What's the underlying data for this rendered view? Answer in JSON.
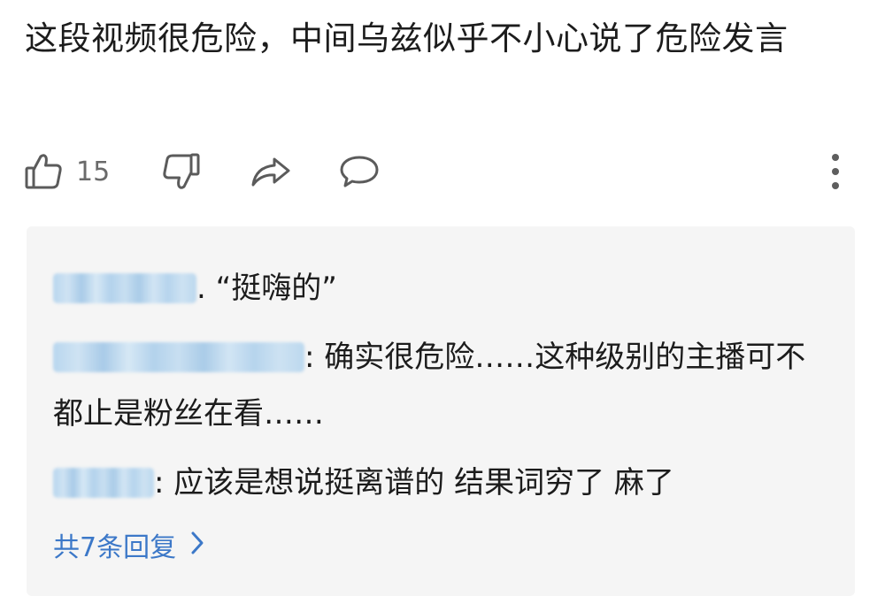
{
  "comment": {
    "text": "这段视频很危险，中间乌兹似乎不小心说了危险发言",
    "like_count": "15"
  },
  "icons": {
    "like": "thumbs-up-icon",
    "dislike": "thumbs-down-icon",
    "share": "share-icon",
    "reply": "comment-bubble-icon",
    "more": "more-vertical-icon",
    "expand": "chevron-right-icon"
  },
  "replies": [
    {
      "user": "[blurred username]",
      "separator": ". ",
      "text": "“挺嗨的”"
    },
    {
      "user": "[blurred username]",
      "separator": ": ",
      "text": "确实很危险……这种级别的主播可不都止是粉丝在看……"
    },
    {
      "user": "[blurred username]",
      "separator": ": ",
      "text": "应该是想说挺离谱的 结果词穷了 麻了"
    }
  ],
  "reply_summary": "共7条回复",
  "colors": {
    "text": "#1c1c1c",
    "icon": "#5b5b5b",
    "reply_bg": "#f5f5f5",
    "link": "#3c78c8",
    "blur_name": "#b8d6ee"
  }
}
